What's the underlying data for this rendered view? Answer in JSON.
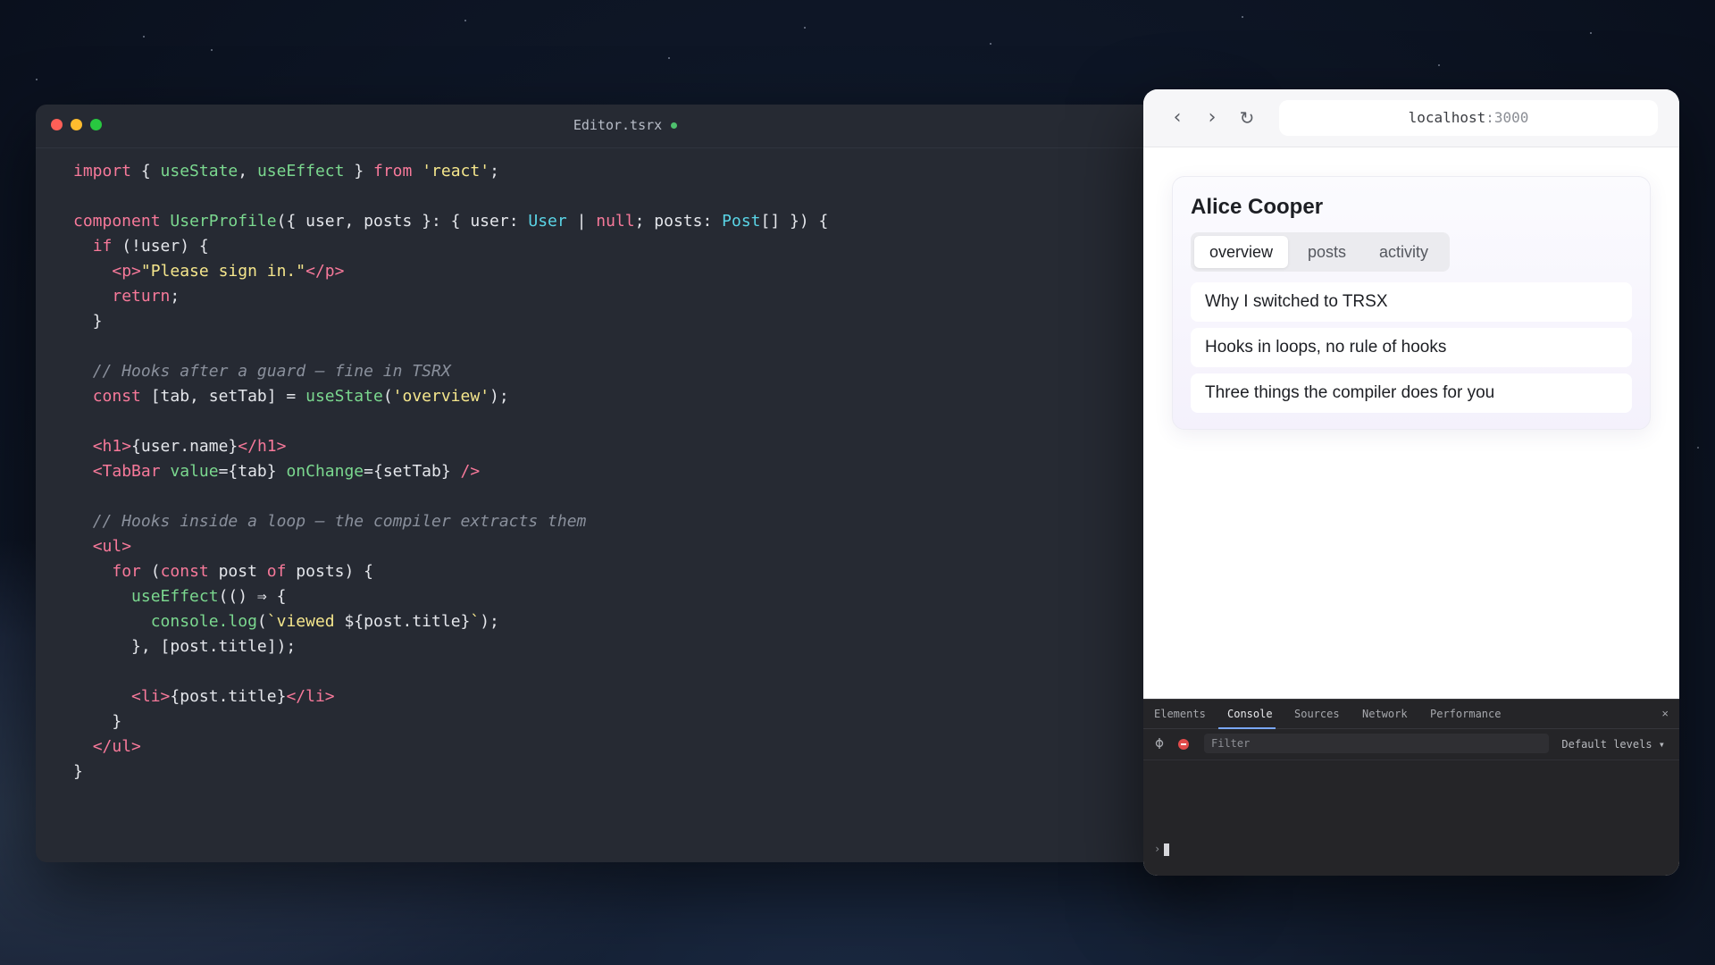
{
  "editor": {
    "filename": "Editor.tsrx",
    "lines": [
      [
        [
          "kw",
          "import"
        ],
        [
          "plain",
          " { "
        ],
        [
          "fn",
          "useState"
        ],
        [
          "plain",
          ", "
        ],
        [
          "fn",
          "useEffect"
        ],
        [
          "plain",
          " } "
        ],
        [
          "kw",
          "from"
        ],
        [
          "plain",
          " "
        ],
        [
          "str",
          "'react'"
        ],
        [
          "plain",
          ";"
        ]
      ],
      [],
      [
        [
          "kw",
          "component"
        ],
        [
          "plain",
          " "
        ],
        [
          "fn",
          "UserProfile"
        ],
        [
          "plain",
          "({ user, posts }: { user: "
        ],
        [
          "type",
          "User"
        ],
        [
          "plain",
          " | "
        ],
        [
          "kw",
          "null"
        ],
        [
          "plain",
          "; posts: "
        ],
        [
          "type",
          "Post"
        ],
        [
          "plain",
          "[] }) {"
        ]
      ],
      [
        [
          "plain",
          "  "
        ],
        [
          "kw",
          "if"
        ],
        [
          "plain",
          " (!user) {"
        ]
      ],
      [
        [
          "plain",
          "    "
        ],
        [
          "tag",
          "<p>"
        ],
        [
          "str",
          "\"Please sign in.\""
        ],
        [
          "tag",
          "</p>"
        ]
      ],
      [
        [
          "plain",
          "    "
        ],
        [
          "kw",
          "return"
        ],
        [
          "plain",
          ";"
        ]
      ],
      [
        [
          "plain",
          "  }"
        ]
      ],
      [],
      [
        [
          "plain",
          "  "
        ],
        [
          "cmt",
          "// Hooks after a guard — fine in TSRX"
        ]
      ],
      [
        [
          "plain",
          "  "
        ],
        [
          "kw",
          "const"
        ],
        [
          "plain",
          " [tab, setTab] = "
        ],
        [
          "fn",
          "useState"
        ],
        [
          "plain",
          "("
        ],
        [
          "str",
          "'overview'"
        ],
        [
          "plain",
          ");"
        ]
      ],
      [],
      [
        [
          "plain",
          "  "
        ],
        [
          "tag",
          "<h1>"
        ],
        [
          "plain",
          "{user.name}"
        ],
        [
          "tag",
          "</h1>"
        ]
      ],
      [
        [
          "plain",
          "  "
        ],
        [
          "tag",
          "<TabBar"
        ],
        [
          "plain",
          " "
        ],
        [
          "attr",
          "value"
        ],
        [
          "plain",
          "={tab} "
        ],
        [
          "attr",
          "onChange"
        ],
        [
          "plain",
          "={setTab} "
        ],
        [
          "tag",
          "/>"
        ]
      ],
      [],
      [
        [
          "plain",
          "  "
        ],
        [
          "cmt",
          "// Hooks inside a loop — the compiler extracts them"
        ]
      ],
      [
        [
          "plain",
          "  "
        ],
        [
          "tag",
          "<ul>"
        ]
      ],
      [
        [
          "plain",
          "    "
        ],
        [
          "kw",
          "for"
        ],
        [
          "plain",
          " ("
        ],
        [
          "kw",
          "const"
        ],
        [
          "plain",
          " post "
        ],
        [
          "kw",
          "of"
        ],
        [
          "plain",
          " posts) {"
        ]
      ],
      [
        [
          "plain",
          "      "
        ],
        [
          "fn",
          "useEffect"
        ],
        [
          "plain",
          "(() ⇒ {"
        ]
      ],
      [
        [
          "plain",
          "        "
        ],
        [
          "fn",
          "console.log"
        ],
        [
          "plain",
          "("
        ],
        [
          "str",
          "`viewed "
        ],
        [
          "plain",
          "${"
        ],
        [
          "plain",
          "post.title"
        ],
        [
          "plain",
          "}"
        ],
        [
          "str",
          "`"
        ],
        [
          "plain",
          ");"
        ]
      ],
      [
        [
          "plain",
          "      }, [post.title]);"
        ]
      ],
      [],
      [
        [
          "plain",
          "      "
        ],
        [
          "tag",
          "<li>"
        ],
        [
          "plain",
          "{post.title}"
        ],
        [
          "tag",
          "</li>"
        ]
      ],
      [
        [
          "plain",
          "    }"
        ]
      ],
      [
        [
          "plain",
          "  "
        ],
        [
          "tag",
          "</ul>"
        ]
      ],
      [
        [
          "plain",
          "}"
        ]
      ]
    ]
  },
  "browser": {
    "url_host": "localhost",
    "url_port": ":3000",
    "back_glyph": "‹",
    "forward_glyph": "›",
    "reload_glyph": "↻",
    "profile": {
      "name": "Alice Cooper",
      "tabs": [
        "overview",
        "posts",
        "activity"
      ],
      "active_tab": "overview",
      "posts": [
        "Why I switched to TRSX",
        "Hooks in loops, no rule of hooks",
        "Three things the compiler does for you"
      ]
    },
    "devtools": {
      "tabs": [
        "Elements",
        "Console",
        "Sources",
        "Network",
        "Performance"
      ],
      "active_tab": "Console",
      "close_glyph": "×",
      "filter_placeholder": "Filter",
      "levels_label": "Default levels ▾",
      "prompt_glyph": "›"
    }
  },
  "colors": {
    "keyword": "#f7799a",
    "function": "#7bd88f",
    "type": "#5ad4e6",
    "string": "#f5e68c",
    "comment": "#8a909c",
    "accent": "#7aa7f5"
  }
}
